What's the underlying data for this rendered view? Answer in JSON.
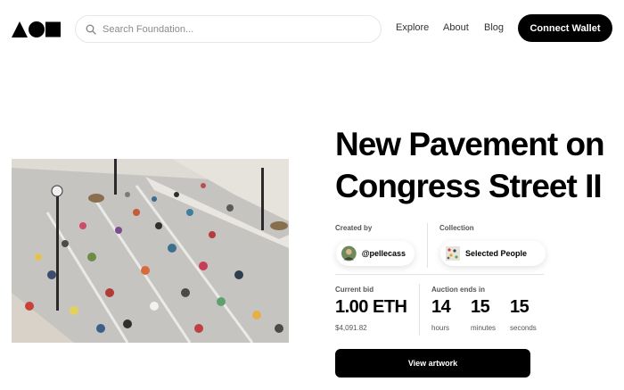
{
  "header": {
    "search_placeholder": "Search Foundation...",
    "nav": {
      "explore": "Explore",
      "about": "About",
      "blog": "Blog"
    },
    "connect_label": "Connect Wallet"
  },
  "artwork": {
    "title_line1": "New Pavement on",
    "title_line2": "Congress Street II",
    "created_by_label": "Created by",
    "creator": "@pellecass",
    "collection_label": "Collection",
    "collection": "Selected People"
  },
  "auction": {
    "current_bid_label": "Current bid",
    "current_bid": "1.00 ETH",
    "current_bid_usd": "$4,091.82",
    "ends_label": "Auction ends in",
    "hours": "14",
    "hours_label": "hours",
    "minutes": "15",
    "minutes_label": "minutes",
    "seconds": "15",
    "seconds_label": "seconds"
  },
  "view_button": "View artwork",
  "colors": {
    "primary": "#000000",
    "background": "#ffffff",
    "muted": "#555555"
  }
}
